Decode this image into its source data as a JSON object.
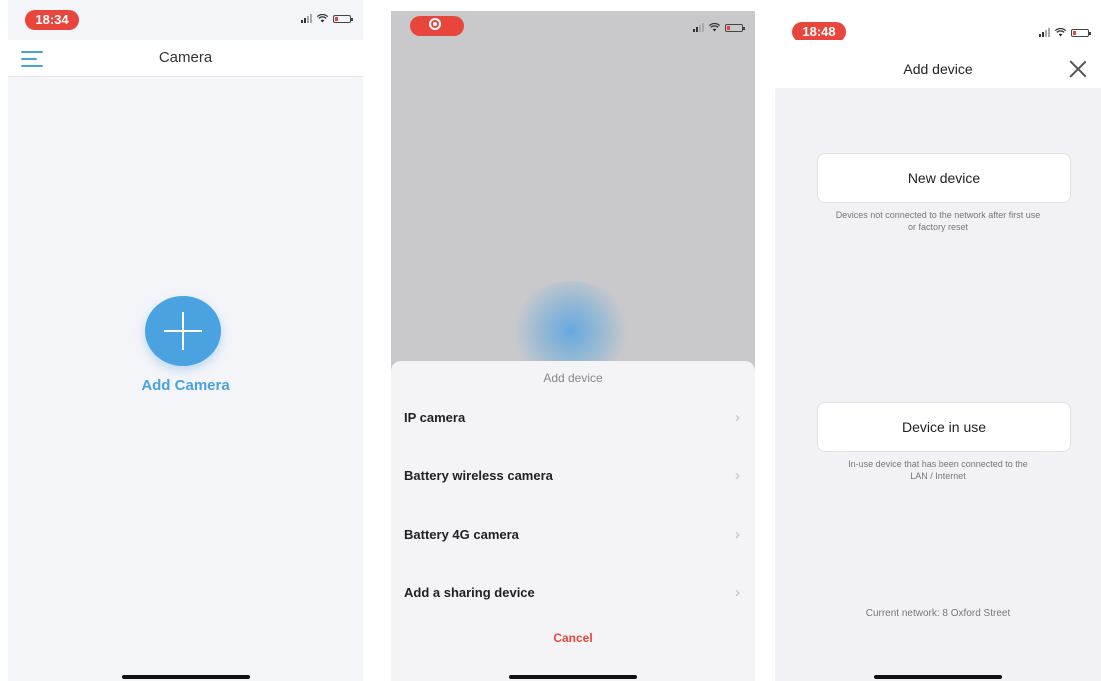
{
  "panel1": {
    "status_time": "18:34",
    "title": "Camera",
    "add_label": "Add Camera",
    "accent": "#4aa3e0"
  },
  "panel2": {
    "sheet_title": "Add device",
    "items": [
      {
        "label": "IP camera"
      },
      {
        "label": "Battery wireless camera"
      },
      {
        "label": "Battery 4G camera"
      },
      {
        "label": "Add a sharing device"
      }
    ],
    "cancel_label": "Cancel",
    "cancel_color": "#e8453c"
  },
  "panel3": {
    "status_time": "18:48",
    "title": "Add device",
    "new_device": {
      "label": "New device",
      "desc_line1": "Devices not connected to the network after first use",
      "desc_line2": "or factory reset"
    },
    "device_in_use": {
      "label": "Device in use",
      "desc_line1": "In-use device that has been connected to the",
      "desc_line2": "LAN / Internet"
    },
    "network_text": "Current network: 8 Oxford Street"
  },
  "icons": [
    "menu-icon",
    "plus-icon",
    "chevron-right-icon",
    "close-icon",
    "signal-icon",
    "wifi-icon",
    "battery-icon",
    "record-icon"
  ]
}
